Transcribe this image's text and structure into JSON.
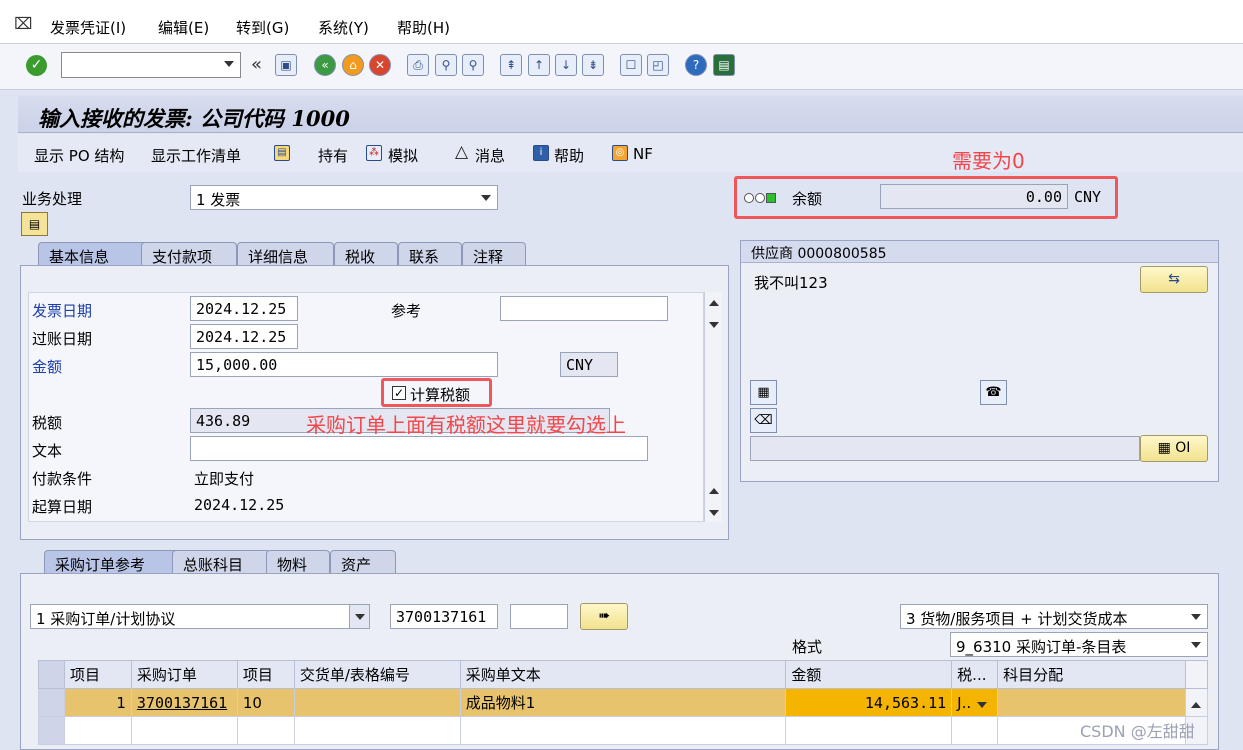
{
  "menu": [
    "发票凭证(I)",
    "编辑(E)",
    "转到(G)",
    "系统(Y)",
    "帮助(H)"
  ],
  "toolbar": {
    "nav_back": "«"
  },
  "page_title": "输入接收的发票: 公司代码 1000",
  "app_toolbar": {
    "show_po": "显示 PO 结构",
    "show_worklist": "显示工作清单",
    "hold": "持有",
    "simulate": "模拟",
    "messages": "消息",
    "help": "帮助",
    "nf": "NF"
  },
  "transaction": {
    "label": "业务处理",
    "value": "1 发票"
  },
  "balance": {
    "label": "余额",
    "value": "0.00",
    "currency": "CNY"
  },
  "annotation_balance": "需要为0",
  "header_tabs": [
    "基本信息",
    "支付款项",
    "详细信息",
    "税收",
    "联系",
    "注释"
  ],
  "basic": {
    "invoice_date_label": "发票日期",
    "invoice_date": "2024.12.25",
    "reference_label": "参考",
    "reference": "",
    "posting_date_label": "过账日期",
    "posting_date": "2024.12.25",
    "amount_label": "金额",
    "amount": "15,000.00",
    "currency": "CNY",
    "calc_tax_label": "计算税额",
    "calc_tax_checked": true,
    "tax_label": "税额",
    "tax": "436.89",
    "text_label": "文本",
    "text": "",
    "payment_terms_label": "付款条件",
    "payment_terms": "立即支付",
    "baseline_date_label": "起算日期",
    "baseline_date": "2024.12.25"
  },
  "annotation_tax": "采购订单上面有税额这里就要勾选上",
  "vendor": {
    "title": "供应商 0000800585",
    "name": "我不叫123",
    "oi_button": "OI"
  },
  "po_tabs": [
    "采购订单参考",
    "总账科目",
    "物料",
    "资产"
  ],
  "po_ref": {
    "type": "1 采购订单/计划协议",
    "po_number": "3700137161",
    "extra": "",
    "layout_select": "3 货物/服务项目 + 计划交货成本",
    "format_label": "格式",
    "format_value": "9_6310 采购订单-条目表"
  },
  "table": {
    "columns": [
      "项目",
      "采购订单",
      "项目",
      "交货单/表格编号",
      "采购单文本",
      "金额",
      "税...",
      "科目分配"
    ],
    "rows": [
      {
        "item": "1",
        "po": "3700137161",
        "po_item": "10",
        "delivery": "",
        "text": "成品物料1",
        "amount": "14,563.11",
        "tax": "J..",
        "acct": ""
      }
    ]
  },
  "watermark": "CSDN @左甜甜"
}
